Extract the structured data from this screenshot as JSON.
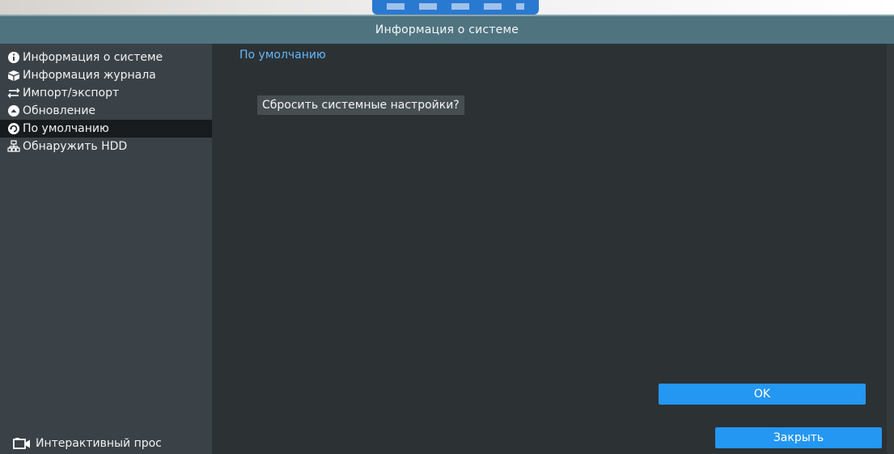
{
  "window": {
    "title": "Информация о системе"
  },
  "sidebar": {
    "items": [
      {
        "label": "Информация о системе",
        "icon": "info-icon",
        "active": false
      },
      {
        "label": "Информация журнала",
        "icon": "journal-icon",
        "active": false
      },
      {
        "label": "Импорт/экспорт",
        "icon": "import-export-icon",
        "active": false
      },
      {
        "label": "Обновление",
        "icon": "update-icon",
        "active": false
      },
      {
        "label": "По умолчанию",
        "icon": "reset-icon",
        "active": true
      },
      {
        "label": "Обнаружить HDD",
        "icon": "hdd-icon",
        "active": false
      }
    ],
    "live_view_label": "Интерактивный прос",
    "live_view_icon": "camera-icon"
  },
  "content": {
    "section_title": "По умолчанию",
    "prompt": "Сбросить системные настройки?"
  },
  "buttons": {
    "ok": "OK",
    "close": "Закрыть"
  },
  "colors": {
    "accent": "#2497f2",
    "section_title": "#62b9ff",
    "titlebar": "#4f7480",
    "sidebar_bg": "#3b4247",
    "content_bg": "#2c3134",
    "active_item_bg": "#171b1e"
  }
}
